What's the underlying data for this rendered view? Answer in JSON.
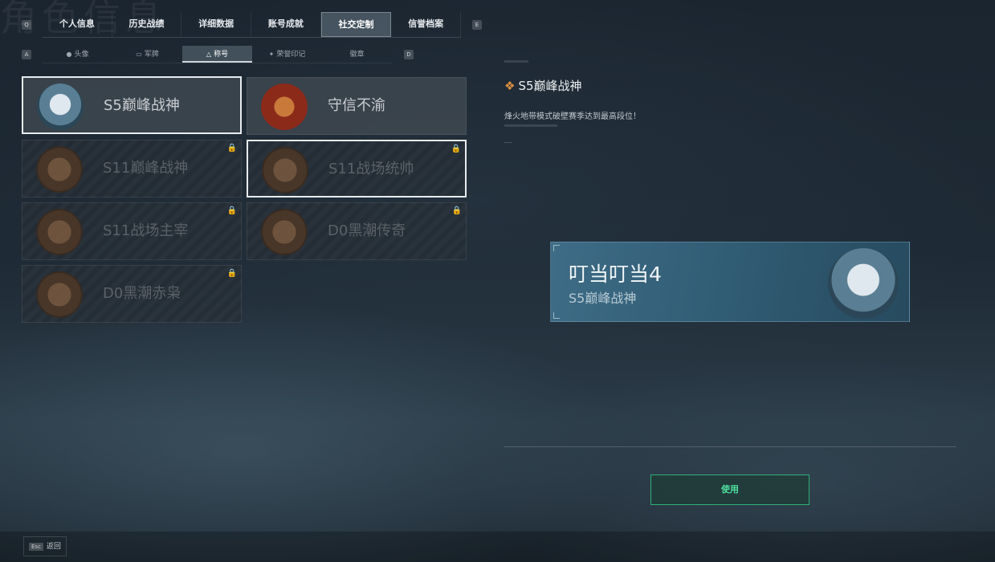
{
  "watermark": "角色信息",
  "keys": {
    "left_tab": "Q",
    "right_tab": "E",
    "left_sub": "A",
    "right_sub": "D"
  },
  "tabs": [
    {
      "label": "个人信息"
    },
    {
      "label": "历史战绩"
    },
    {
      "label": "详细数据"
    },
    {
      "label": "账号成就"
    },
    {
      "label": "社交定制"
    },
    {
      "label": "信誉档案"
    }
  ],
  "subtabs": [
    {
      "label": "头像"
    },
    {
      "label": "军牌"
    },
    {
      "label": "称号"
    },
    {
      "label": "荣誉印记"
    },
    {
      "label": "徽章"
    }
  ],
  "cards": [
    {
      "name": "S5巅峰战神"
    },
    {
      "name": "守信不渝"
    },
    {
      "name": "S11巅峰战神"
    },
    {
      "name": "S11战场统帅"
    },
    {
      "name": "S11战场主宰"
    },
    {
      "name": "D0黑潮传奇"
    },
    {
      "name": "D0黑潮赤枭"
    }
  ],
  "detail": {
    "title": "S5巅峰战神",
    "description": "烽火地带模式破壁赛季达到最高段位！"
  },
  "preview": {
    "player": "叮当叮当4",
    "title": "S5巅峰战神"
  },
  "use_button": "使用",
  "footer": {
    "esc_key": "Esc",
    "esc_label": "返回"
  }
}
